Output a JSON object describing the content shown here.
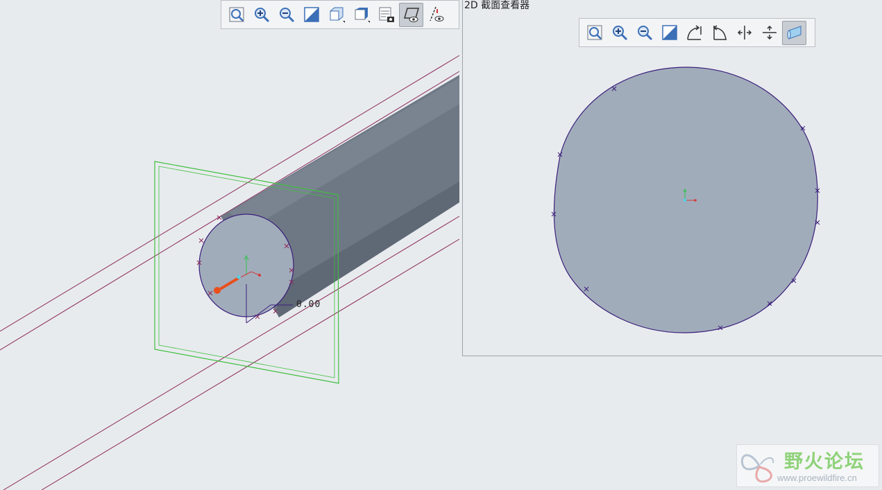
{
  "main_toolbar": {
    "buttons": [
      {
        "name": "refit-icon",
        "active": false
      },
      {
        "name": "zoom-in-icon",
        "active": false
      },
      {
        "name": "zoom-out-icon",
        "active": false
      },
      {
        "name": "repaint-icon",
        "active": false
      },
      {
        "name": "display-style-icon",
        "active": false
      },
      {
        "name": "saved-orientations-icon",
        "active": false
      },
      {
        "name": "view-manager-icon",
        "active": false
      },
      {
        "name": "section-view-icon",
        "active": true
      },
      {
        "name": "datum-display-icon",
        "active": false
      }
    ]
  },
  "section_viewer": {
    "title": "2D 截面查看器",
    "toolbar": [
      {
        "name": "refit-icon",
        "active": false
      },
      {
        "name": "zoom-in-icon",
        "active": false
      },
      {
        "name": "zoom-out-icon",
        "active": false
      },
      {
        "name": "repaint-icon",
        "active": false
      },
      {
        "name": "rotate-ccw-icon",
        "active": false
      },
      {
        "name": "rotate-cw-icon",
        "active": false
      },
      {
        "name": "flip-horizontal-icon",
        "active": false
      },
      {
        "name": "flip-vertical-icon",
        "active": false
      },
      {
        "name": "shaded-section-icon",
        "active": true
      }
    ]
  },
  "viewport": {
    "dimension_label": "0.00"
  },
  "watermark": {
    "name_cn": "野火论坛",
    "url": "www.proewildfire.cn"
  },
  "colors": {
    "background": "#e8ebee",
    "section_fill": "#a1acbb",
    "rod_body": "#6e7885",
    "section_edge": "#3a1f7a",
    "plane_green": "#3fbf3f",
    "axis_line": "#8a2a5a",
    "handle_orange": "#e8501e"
  }
}
